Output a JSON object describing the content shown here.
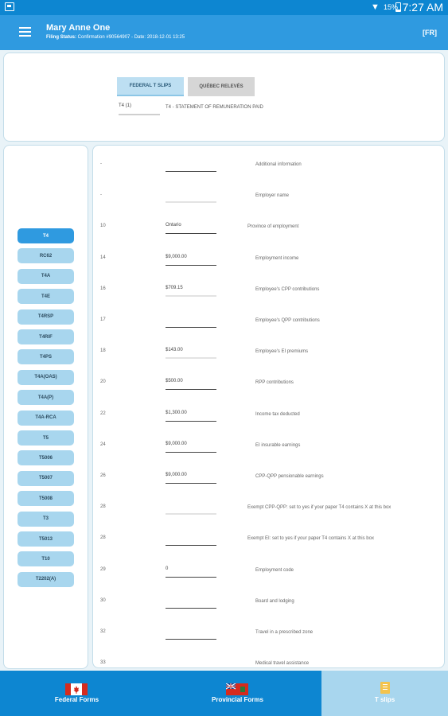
{
  "status_bar": {
    "battery": "15%",
    "time": "7:27 AM"
  },
  "header": {
    "title": "Mary Anne One",
    "filing_status_label": "Filing Status:",
    "confirmation_text": "Confirmation #90564907 - Date: 2018-12-01 13:25",
    "language_button": "[FR]"
  },
  "tabs": {
    "federal": "FEDERAL T SLIPS",
    "quebec": "QUÉBEC RELEVÉS"
  },
  "slip_info": {
    "code": "T4 (1)",
    "description": "T4 - STATEMENT OF REMUNERATION PAID"
  },
  "sidebar": {
    "items": [
      "T4",
      "RC62",
      "T4A",
      "T4E",
      "T4RSP",
      "T4RIF",
      "T4PS",
      "T4A(OAS)",
      "T4A(P)",
      "T4A-RCA",
      "T5",
      "T5006",
      "T5007",
      "T5008",
      "T3",
      "T5013",
      "T10",
      "T2202(A)"
    ],
    "active": "T4"
  },
  "form_rows": [
    {
      "box": "-",
      "value": "",
      "label": "Additional information",
      "disabled": false,
      "indent": true
    },
    {
      "box": "-",
      "value": "",
      "label": "Employer name",
      "disabled": true,
      "indent": true
    },
    {
      "box": "10",
      "value": "Ontario",
      "label": "Province of employment",
      "disabled": false,
      "indent": false
    },
    {
      "box": "14",
      "value": "$9,000.00",
      "label": "Employment income",
      "disabled": false,
      "indent": true
    },
    {
      "box": "16",
      "value": "$709.15",
      "label": "Employee's CPP contributions",
      "disabled": true,
      "indent": true
    },
    {
      "box": "17",
      "value": "",
      "label": "Employee's QPP contributions",
      "disabled": false,
      "indent": true
    },
    {
      "box": "18",
      "value": "$143.00",
      "label": "Employee's EI premiums",
      "disabled": true,
      "indent": true
    },
    {
      "box": "20",
      "value": "$500.00",
      "label": "RPP contributions",
      "disabled": false,
      "indent": true
    },
    {
      "box": "22",
      "value": "$1,300.00",
      "label": "Income tax deducted",
      "disabled": false,
      "indent": true
    },
    {
      "box": "24",
      "value": "$9,000.00",
      "label": "EI insurable earnings",
      "disabled": false,
      "indent": true
    },
    {
      "box": "26",
      "value": "$9,000.00",
      "label": "CPP-QPP pensionable earnings",
      "disabled": false,
      "indent": true
    },
    {
      "box": "28",
      "value": "",
      "label": "Exempt CPP-QPP: set to yes if your paper T4 contains X at this box",
      "disabled": true,
      "indent": false
    },
    {
      "box": "28",
      "value": "",
      "label": "Exempt EI: set to yes if your paper T4 contains X at this box",
      "disabled": false,
      "indent": false
    },
    {
      "box": "29",
      "value": "0",
      "label": "Employment code",
      "disabled": false,
      "indent": true
    },
    {
      "box": "30",
      "value": "",
      "label": "Board and lodging",
      "disabled": false,
      "indent": true
    },
    {
      "box": "32",
      "value": "",
      "label": "Travel in a prescribed zone",
      "disabled": false,
      "indent": true
    },
    {
      "box": "33",
      "value": "",
      "label": "Medical travel assistance",
      "disabled": false,
      "indent": true
    }
  ],
  "bottom_nav": {
    "federal": "Federal Forms",
    "provincial": "Provincial Forms",
    "tslips": "T slips"
  },
  "colors": {
    "status_bar": "#0d86d1",
    "app_bar": "#2f9ae0",
    "active_side": "#2f9ae0",
    "side_item": "#a8d6ee"
  }
}
